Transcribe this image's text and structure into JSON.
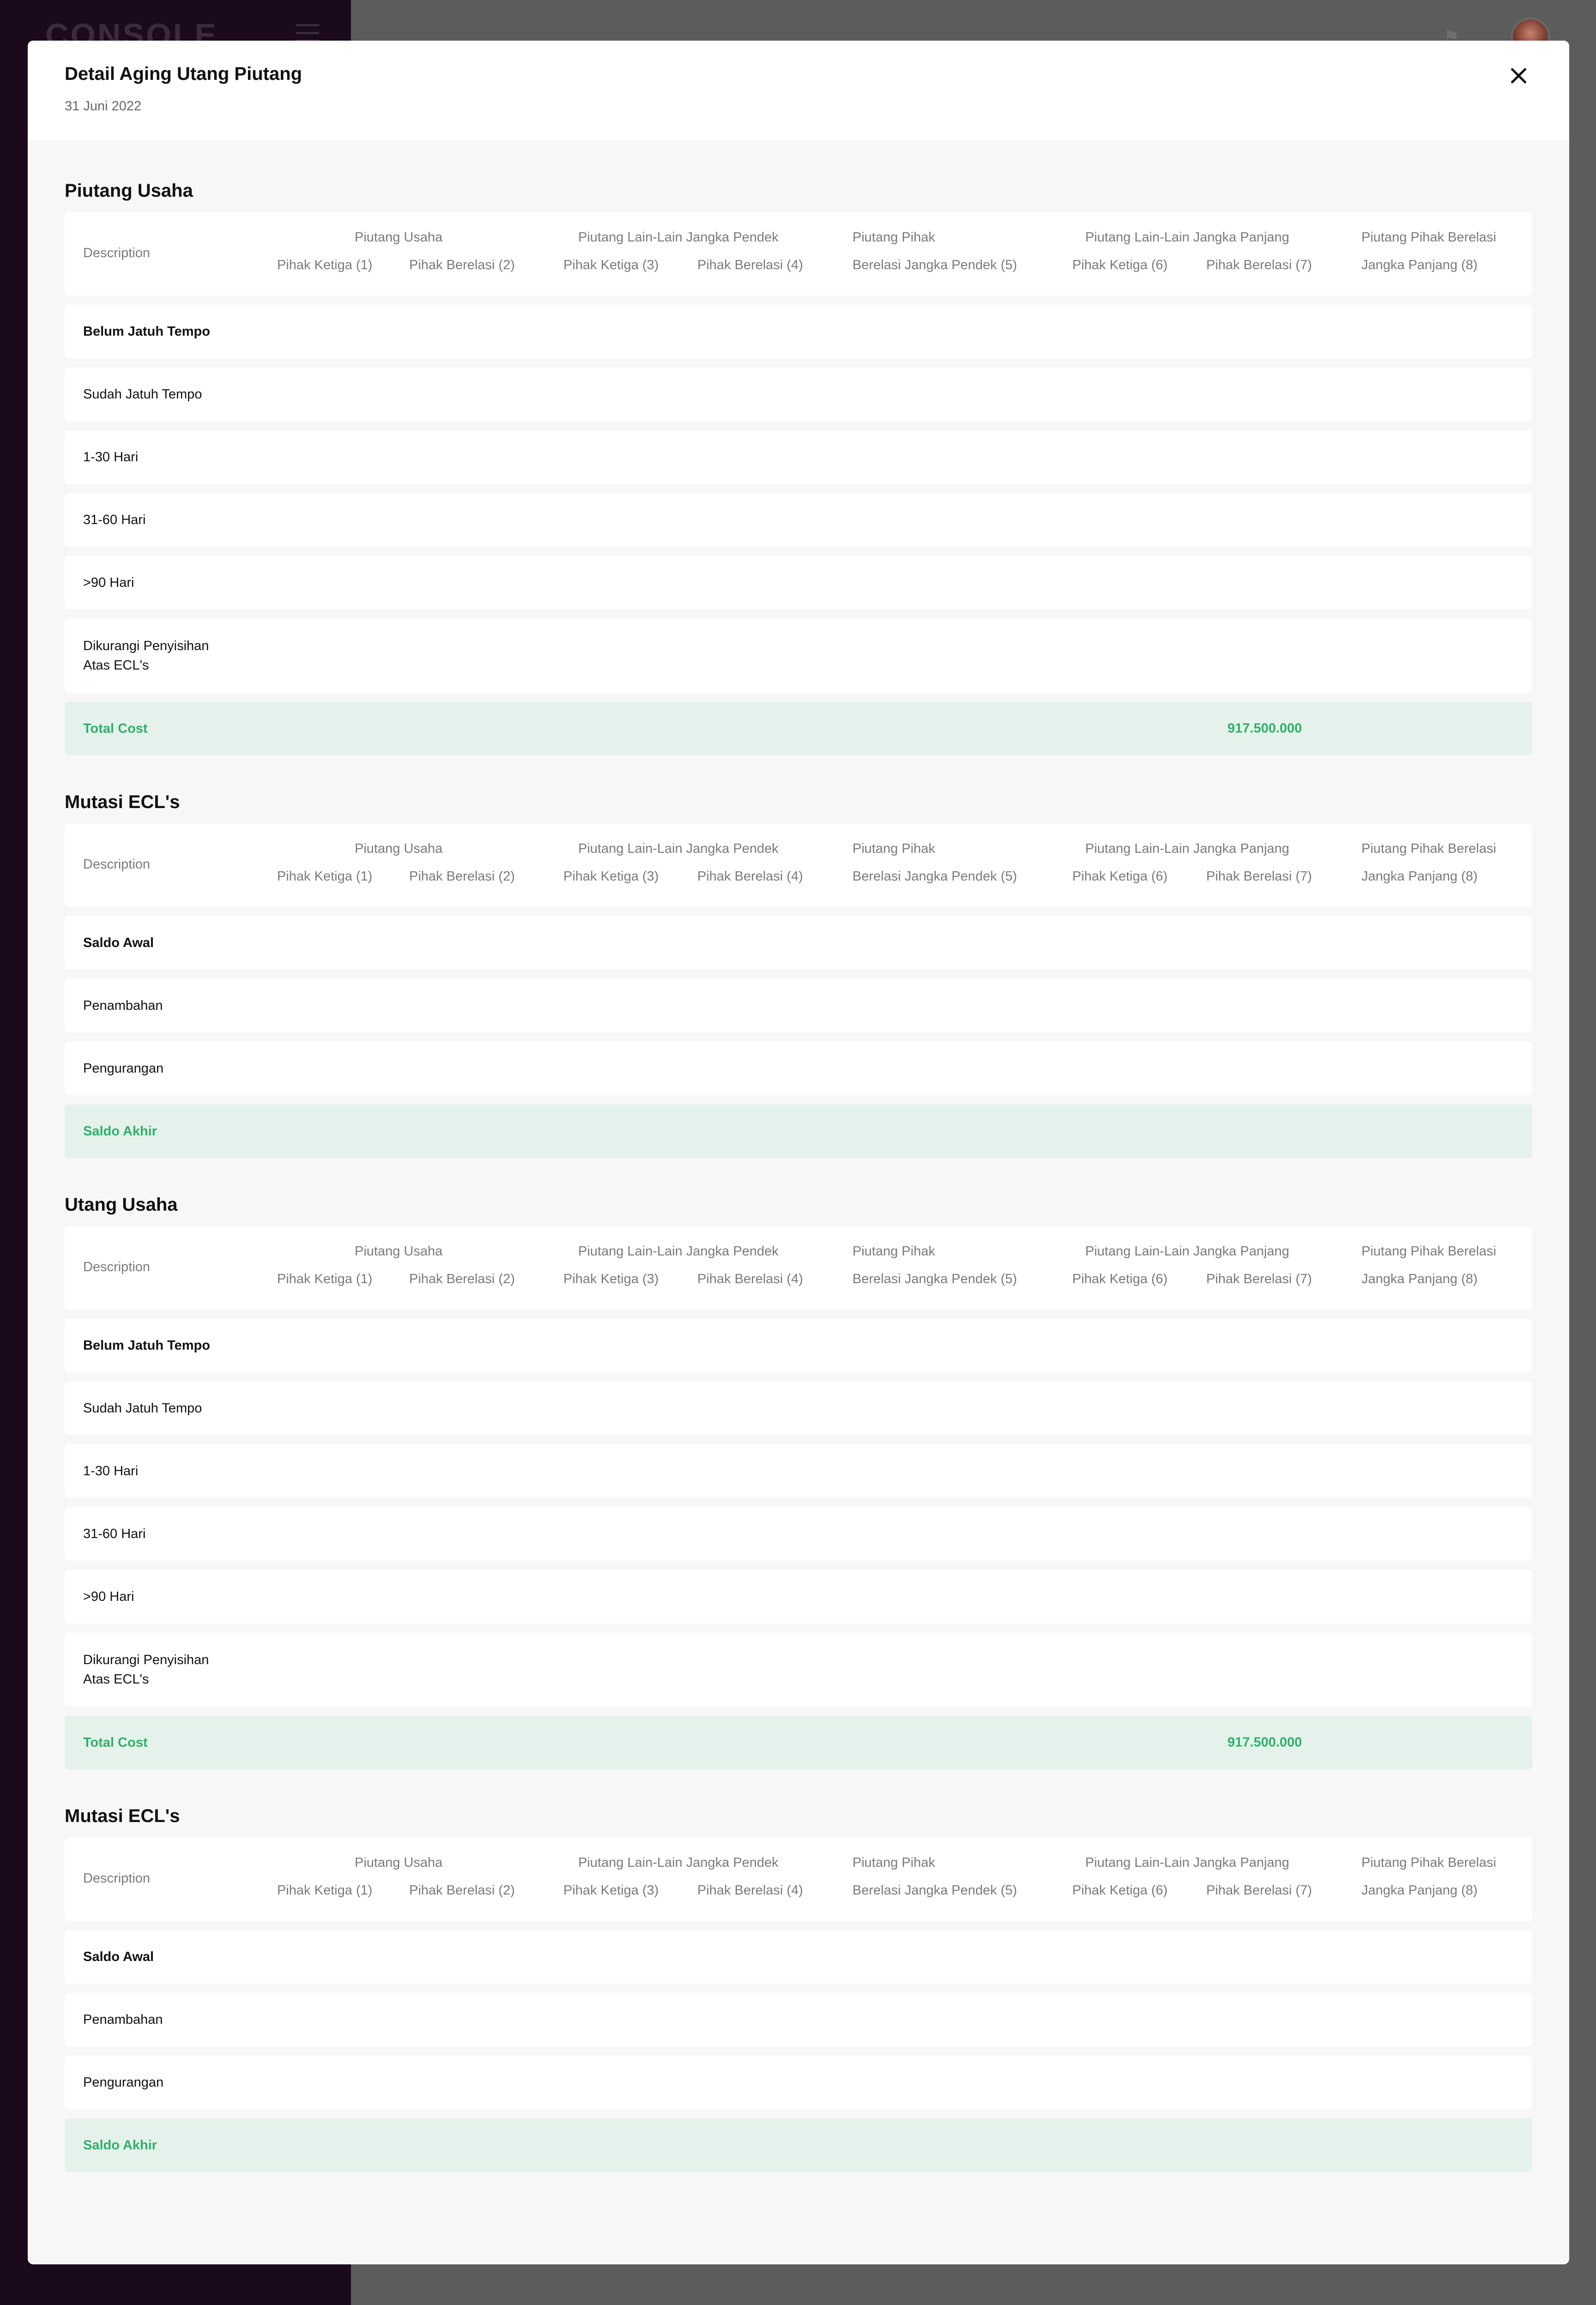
{
  "app": {
    "brand": "CONSOLE"
  },
  "modal": {
    "title": "Detail Aging Utang Piutang",
    "date": "31 Juni 2022"
  },
  "columns": {
    "description": "Description",
    "group1_top": "Piutang Usaha",
    "group1_a": "Pihak Ketiga (1)",
    "group1_b": "Pihak Berelasi (2)",
    "group2_top": "Piutang Lain-Lain Jangka Pendek",
    "group2_a": "Pihak Ketiga (3)",
    "group2_b": "Pihak Berelasi (4)",
    "col5_top": "Piutang Pihak",
    "col5_bottom": "Berelasi Jangka Pendek (5)",
    "group3_top": "Piutang Lain-Lain Jangka Panjang",
    "group3_a": "Pihak Ketiga (6)",
    "group3_b": "Pihak Berelasi (7)",
    "col8_top": "Piutang Pihak Berelasi",
    "col8_bottom": "Jangka Panjang (8)"
  },
  "sections": [
    {
      "title": "Piutang Usaha",
      "rows": [
        "Belum Jatuh Tempo",
        "Sudah Jatuh Tempo",
        "1-30 Hari",
        "31-60 Hari",
        ">90 Hari",
        "Dikurangi Penyisihan",
        "Atas ECL's"
      ],
      "total_label": "Total Cost",
      "total_value": "917.500.000"
    },
    {
      "title": "Mutasi ECL's",
      "rows": [
        "Saldo Awal",
        "Penambahan",
        "Pengurangan"
      ],
      "total_label": "Saldo Akhir"
    },
    {
      "title": "Utang Usaha",
      "rows": [
        "Belum Jatuh Tempo",
        "Sudah Jatuh Tempo",
        "1-30 Hari",
        "31-60 Hari",
        ">90 Hari",
        "Dikurangi Penyisihan",
        "Atas ECL's"
      ],
      "total_label": "Total Cost",
      "total_value": "917.500.000"
    },
    {
      "title": "Mutasi ECL's",
      "rows": [
        "Saldo Awal",
        "Penambahan",
        "Pengurangan"
      ],
      "total_label": "Saldo Akhir"
    }
  ]
}
